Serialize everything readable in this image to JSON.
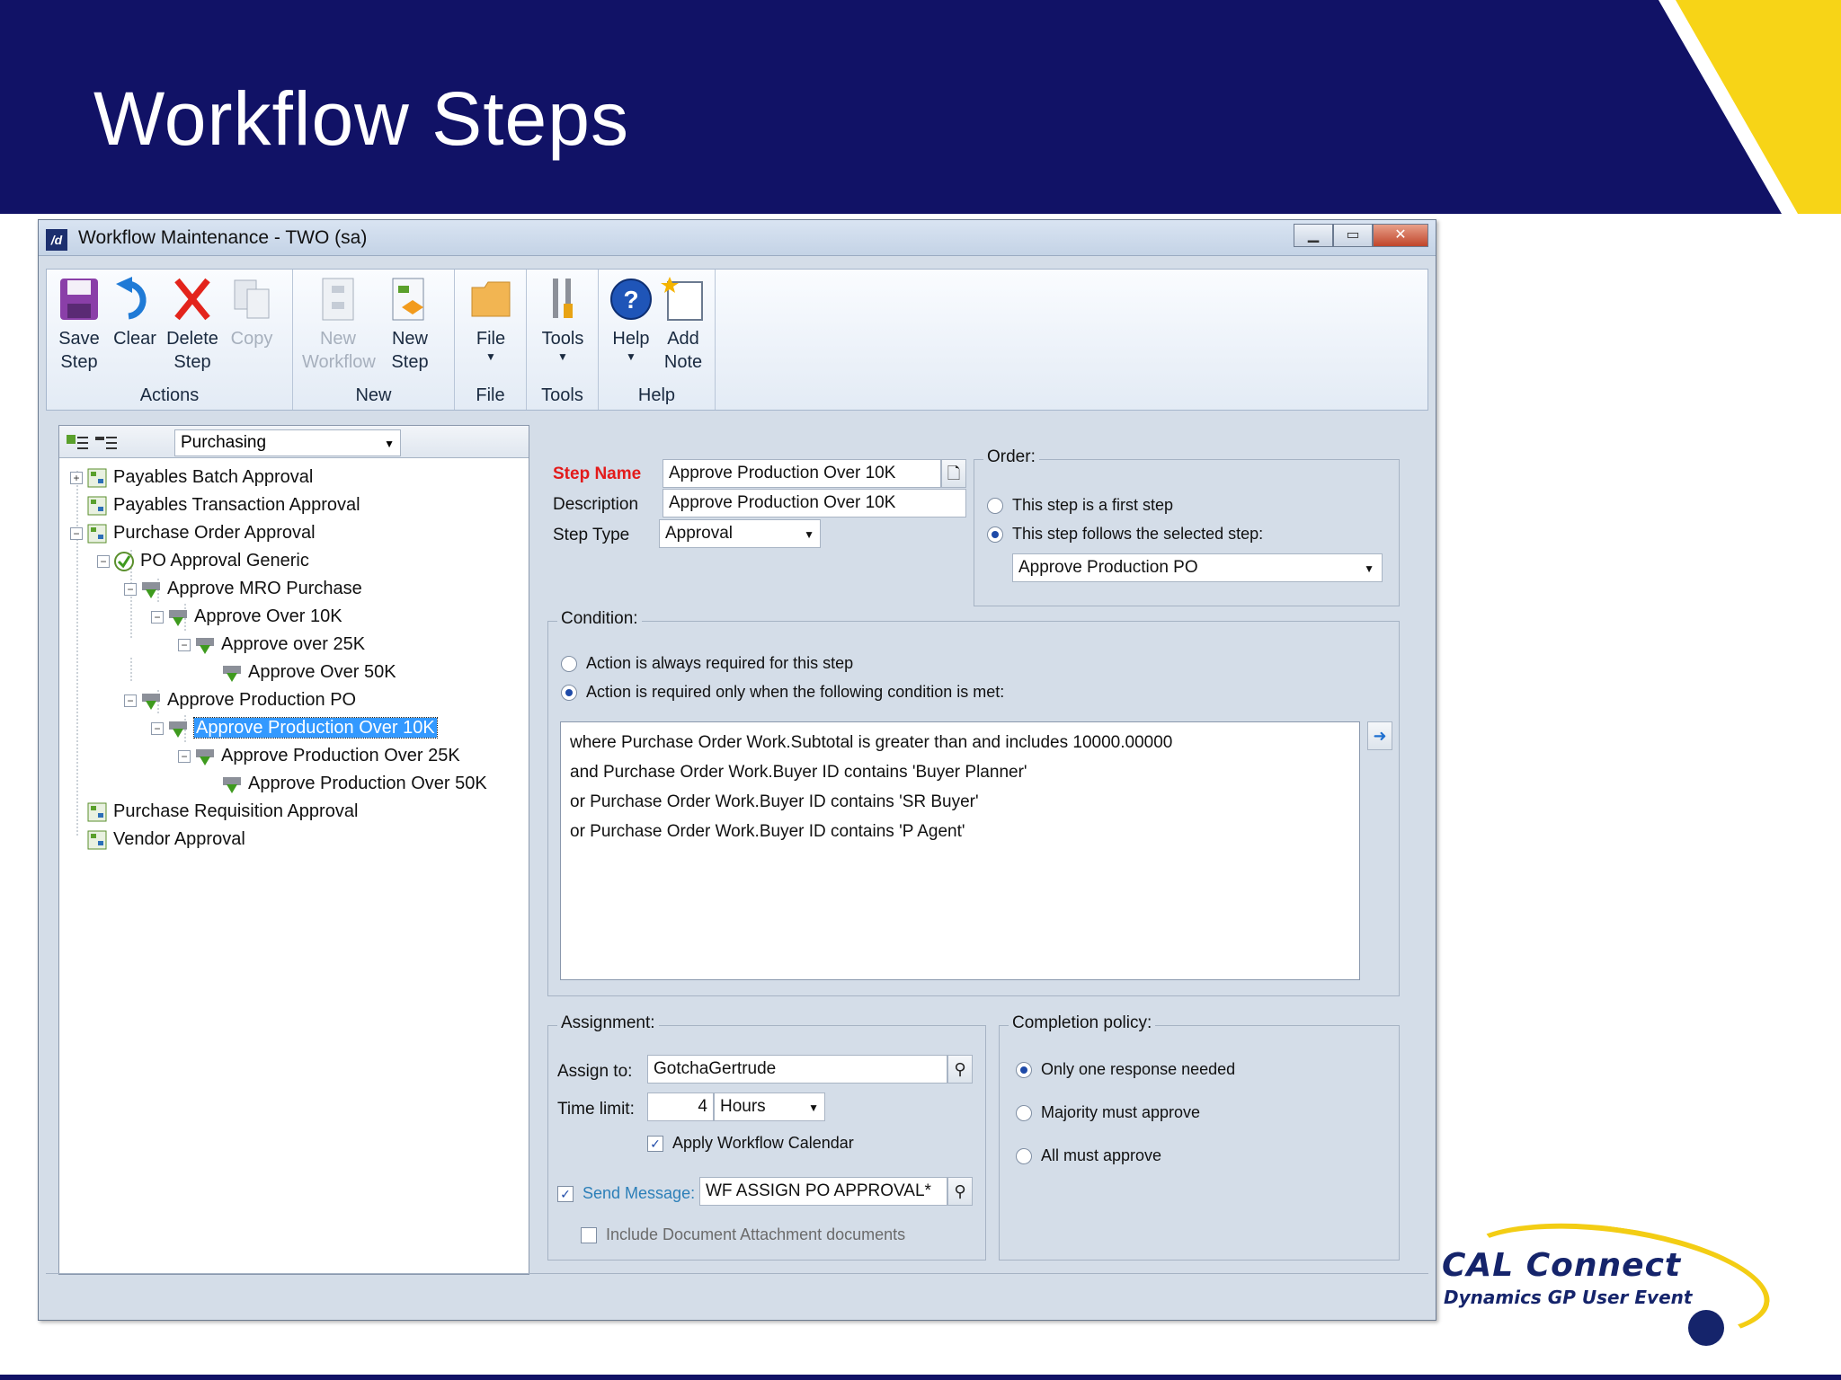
{
  "slide": {
    "title": "Workflow Steps",
    "logo_main": "CAL Connect",
    "logo_sub": "Dynamics GP User Event",
    "colors": {
      "banner": "#111266",
      "accent_yellow": "#f7d417",
      "selection": "#3399ff",
      "required_label": "#e31b1b"
    }
  },
  "window": {
    "title": "Workflow Maintenance  -  TWO (sa)",
    "controls": {
      "minimize": "minimize-icon",
      "maximize": "maximize-icon",
      "close": "close-icon"
    }
  },
  "ribbon": {
    "groups": [
      {
        "label": "Actions",
        "buttons": [
          {
            "label1": "Save",
            "label2": "Step",
            "icon": "save-icon"
          },
          {
            "label1": "Clear",
            "label2": "",
            "icon": "undo-icon"
          },
          {
            "label1": "Delete",
            "label2": "Step",
            "icon": "delete-icon"
          },
          {
            "label1": "Copy",
            "label2": "",
            "icon": "copy-icon",
            "disabled": true
          }
        ]
      },
      {
        "label": "New",
        "buttons": [
          {
            "label1": "New",
            "label2": "Workflow",
            "icon": "new-workflow-icon",
            "disabled": true
          },
          {
            "label1": "New",
            "label2": "Step",
            "icon": "new-step-icon"
          }
        ]
      },
      {
        "label": "File",
        "buttons": [
          {
            "label1": "File",
            "label2": "▼",
            "icon": "folder-icon"
          }
        ]
      },
      {
        "label": "Tools",
        "buttons": [
          {
            "label1": "Tools",
            "label2": "▼",
            "icon": "tools-icon"
          }
        ]
      },
      {
        "label": "Help",
        "buttons": [
          {
            "label1": "Help",
            "label2": "▼",
            "icon": "help-icon"
          },
          {
            "label1": "Add",
            "label2": "Note",
            "icon": "add-note-icon"
          }
        ]
      }
    ]
  },
  "tree": {
    "dropdown_value": "Purchasing",
    "items": [
      "Payables Batch Approval",
      "Payables Transaction Approval",
      "Purchase Order Approval",
      "PO Approval Generic",
      "Approve MRO Purchase",
      "Approve Over 10K",
      "Approve over 25K",
      "Approve Over 50K",
      "Approve Production PO",
      "Approve Production Over 10K",
      "Approve Production Over 25K",
      "Approve Production Over 50K",
      "Purchase Requisition Approval",
      "Vendor Approval"
    ],
    "selected": "Approve Production Over 10K"
  },
  "form": {
    "step_name_label": "Step Name",
    "step_name_value": "Approve Production Over 10K",
    "description_label": "Description",
    "description_value": "Approve Production Over 10K",
    "step_type_label": "Step Type",
    "step_type_value": "Approval",
    "order": {
      "title": "Order:",
      "option1": "This step is a first step",
      "option2": "This step follows the selected step:",
      "selected_step": "Approve Production PO"
    },
    "condition": {
      "title": "Condition:",
      "option1": "Action is always required for this step",
      "option2": "Action is required only when the following condition is met:",
      "lines": [
        "where Purchase Order Work.Subtotal is greater than and includes 10000.00000",
        "and Purchase Order Work.Buyer ID contains 'Buyer Planner'",
        "or Purchase Order Work.Buyer ID contains 'SR Buyer'",
        "or Purchase Order Work.Buyer ID contains 'P Agent'"
      ]
    },
    "assignment": {
      "title": "Assignment:",
      "assign_to_label": "Assign to:",
      "assign_to_value": "GotchaGertrude",
      "time_limit_label": "Time limit:",
      "time_limit_value": "4",
      "time_unit": "Hours",
      "apply_calendar": "Apply Workflow Calendar",
      "send_message_label": "Send Message:",
      "send_message_value": "WF ASSIGN PO APPROVAL*",
      "include_docs": "Include Document Attachment documents"
    },
    "completion": {
      "title": "Completion policy:",
      "option1": "Only one response needed",
      "option2": "Majority must approve",
      "option3": "All must approve"
    }
  }
}
